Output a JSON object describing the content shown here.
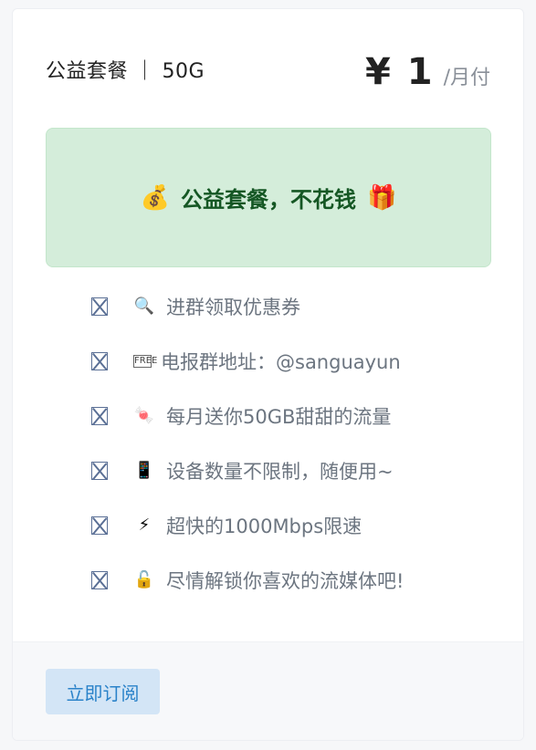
{
  "plan": {
    "name": "公益套餐 ｜ 50G",
    "price": "¥ 1",
    "period": "/月付"
  },
  "banner": {
    "emoji_left": "💰",
    "title": "公益套餐，不花钱",
    "emoji_right": "🎁"
  },
  "features": [
    {
      "icon": "magnifier-icon",
      "emoji": "🔍",
      "text": "进群领取优惠券"
    },
    {
      "icon": "free-button-icon",
      "emoji": "FREE",
      "text": "电报群地址：@sanguayun"
    },
    {
      "icon": "candy-icon",
      "emoji": "🍬",
      "text": "每月送你50GB甜甜的流量"
    },
    {
      "icon": "mobile-phone-icon",
      "emoji": "📱",
      "text": "设备数量不限制，随便用~"
    },
    {
      "icon": "lightning-icon",
      "emoji": "⚡",
      "text": "超快的1000Mbps限速"
    },
    {
      "icon": "unlock-icon",
      "emoji": "🔓",
      "text": "尽情解锁你喜欢的流媒体吧!"
    }
  ],
  "footer": {
    "subscribe_label": "立即订阅"
  },
  "colors": {
    "banner_bg": "#d4edda",
    "banner_text": "#155724",
    "button_bg": "#d3e5f6",
    "button_text": "#2a82c9"
  }
}
